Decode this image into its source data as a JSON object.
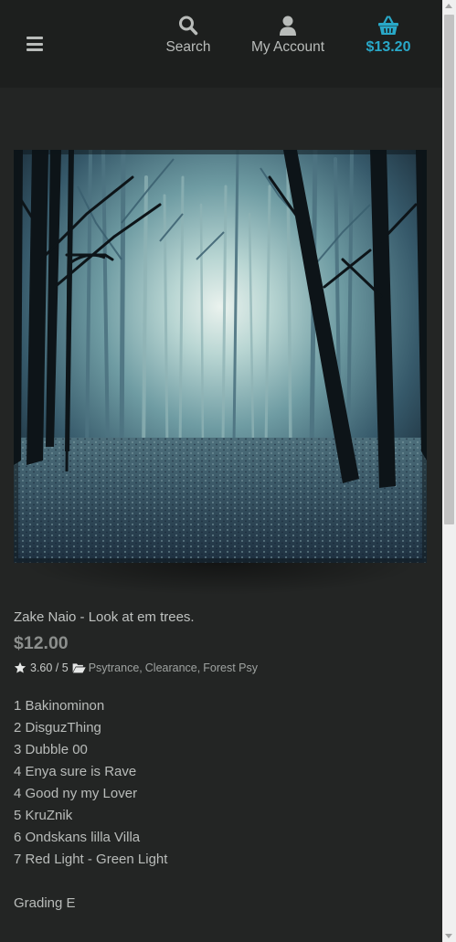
{
  "header": {
    "menu_icon": "hamburger-icon",
    "search": {
      "icon": "search-icon",
      "label": "Search"
    },
    "account": {
      "icon": "user-icon",
      "label": "My Account"
    },
    "cart": {
      "icon": "basket-icon",
      "total": "$13.20",
      "color": "#29a8c8"
    }
  },
  "product": {
    "image_alt": "foggy forest",
    "title": "Zake Naio - Look at em trees.",
    "price": "$12.00",
    "rating": "3.60 / 5",
    "categories": [
      "Psytrance",
      "Clearance",
      "Forest Psy"
    ],
    "tracks": [
      "1 Bakinominon",
      "2 DisguzThing",
      "3 Dubble 00",
      "4 Enya sure is Rave",
      "4 Good ny my Lover",
      "5 KruZnik",
      "6 Ondskans lilla Villa",
      "7 Red Light - Green Light"
    ],
    "grading": "Grading E"
  }
}
